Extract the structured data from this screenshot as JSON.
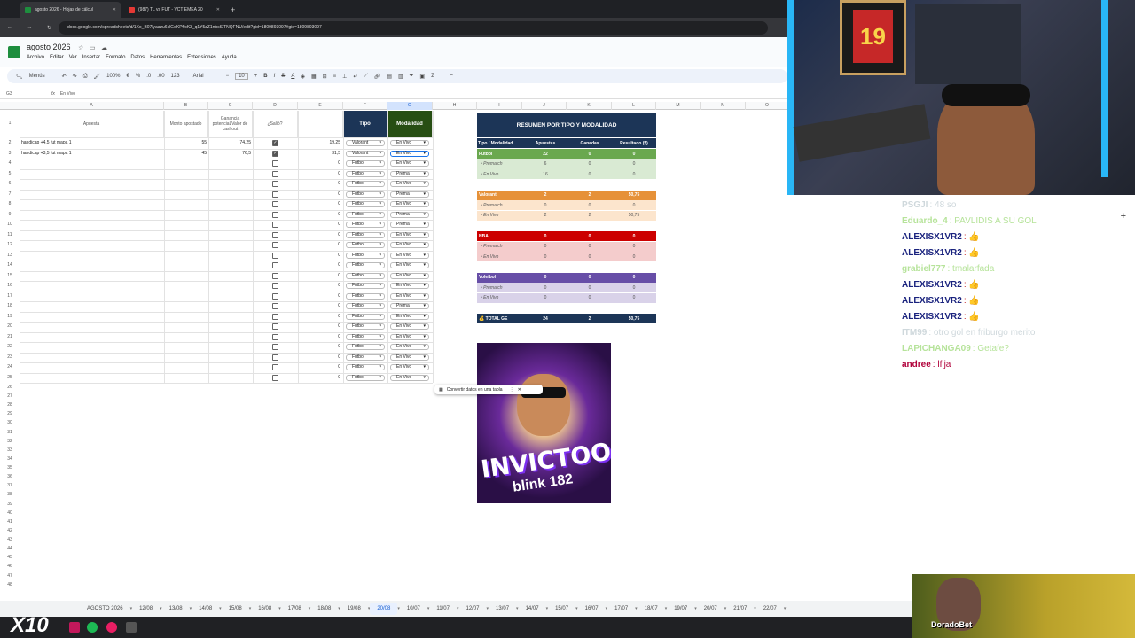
{
  "browser": {
    "tabs": [
      {
        "label": "agosto 2026 - Hojas de cálcul",
        "active": true
      },
      {
        "label": "(987) TL vs FUT - VCT EMEA 20",
        "active": false
      }
    ],
    "url": "docs.google.com/spreadsheets/d/1Xo_B07lyaazu6clGqKPffcK3_q1Y5zZ1nbcSiTNQFNU/edit?gid=1809893097#gid=1809893097"
  },
  "sheets": {
    "doc_title": "agosto 2026",
    "menu": [
      "Archivo",
      "Editar",
      "Ver",
      "Insertar",
      "Formato",
      "Datos",
      "Herramientas",
      "Extensiones",
      "Ayuda"
    ],
    "toolbar": {
      "menus": "Menús",
      "zoom": "100%",
      "font": "Arial",
      "font_size": "10",
      "fmt_123": "123"
    },
    "cell_ref": "G3",
    "formula": "En Vivo",
    "columns": [
      "A",
      "B",
      "C",
      "D",
      "E",
      "F",
      "G",
      "H",
      "I",
      "J",
      "K",
      "L",
      "M",
      "N",
      "O"
    ],
    "headers": {
      "apuesta": "Apuesta",
      "monto": "Monto apostado",
      "ganancia": "Ganancia potencial/Valor de cashout",
      "salio": "¿Salió?",
      "tipo": "Tipo",
      "modalidad": "Modalidad"
    },
    "rows": [
      {
        "n": "1"
      },
      {
        "n": "2",
        "apuesta": "handicap +4,5 fut mapa 1",
        "monto": "55",
        "ganancia": "74,25",
        "check": true,
        "e": "19,25",
        "tipo": "Valorant",
        "mod": "En Vivo"
      },
      {
        "n": "3",
        "apuesta": "handicap +3,5 fut mapa 1",
        "monto": "45",
        "ganancia": "76,5",
        "check": true,
        "e": "31,5",
        "tipo": "Valorant",
        "mod": "En Vivo"
      },
      {
        "n": "4",
        "e": "0",
        "tipo": "Fútbol",
        "mod": "En Vivo"
      },
      {
        "n": "5",
        "e": "0",
        "tipo": "Fútbol",
        "mod": "Prema"
      },
      {
        "n": "6",
        "e": "0",
        "tipo": "Fútbol",
        "mod": "En Vivo"
      },
      {
        "n": "7",
        "e": "0",
        "tipo": "Fútbol",
        "mod": "Prema"
      },
      {
        "n": "8",
        "e": "0",
        "tipo": "Fútbol",
        "mod": "En Vivo"
      },
      {
        "n": "9",
        "e": "0",
        "tipo": "Fútbol",
        "mod": "Prema"
      },
      {
        "n": "10",
        "e": "0",
        "tipo": "Fútbol",
        "mod": "Prema"
      },
      {
        "n": "11",
        "e": "0",
        "tipo": "Fútbol",
        "mod": "En Vivo"
      },
      {
        "n": "12",
        "e": "0",
        "tipo": "Fútbol",
        "mod": "En Vivo"
      },
      {
        "n": "13",
        "e": "0",
        "tipo": "Fútbol",
        "mod": "En Vivo"
      },
      {
        "n": "14",
        "e": "0",
        "tipo": "Fútbol",
        "mod": "En Vivo"
      },
      {
        "n": "15",
        "e": "0",
        "tipo": "Fútbol",
        "mod": "En Vivo"
      },
      {
        "n": "16",
        "e": "0",
        "tipo": "Fútbol",
        "mod": "En Vivo"
      },
      {
        "n": "17",
        "e": "0",
        "tipo": "Fútbol",
        "mod": "En Vivo"
      },
      {
        "n": "18",
        "e": "0",
        "tipo": "Fútbol",
        "mod": "Prema"
      },
      {
        "n": "19",
        "e": "0",
        "tipo": "Fútbol",
        "mod": "En Vivo"
      },
      {
        "n": "20",
        "e": "0",
        "tipo": "Fútbol",
        "mod": "En Vivo"
      },
      {
        "n": "21",
        "e": "0",
        "tipo": "Fútbol",
        "mod": "En Vivo"
      },
      {
        "n": "22",
        "e": "0",
        "tipo": "Fútbol",
        "mod": "En Vivo"
      },
      {
        "n": "23",
        "e": "0",
        "tipo": "Fútbol",
        "mod": "En Vivo"
      },
      {
        "n": "24",
        "e": "0",
        "tipo": "Fútbol",
        "mod": "En Vivo"
      },
      {
        "n": "25",
        "e": "0",
        "tipo": "Fútbol",
        "mod": "En Vivo"
      }
    ],
    "extra_row_numbers": [
      "26",
      "27",
      "28",
      "29",
      "30",
      "31",
      "32",
      "33",
      "34",
      "35",
      "36",
      "37",
      "38",
      "39",
      "40",
      "41",
      "42",
      "43",
      "44",
      "45",
      "46",
      "47",
      "48"
    ],
    "summary": {
      "title": "RESUMEN POR TIPO Y MODALIDAD",
      "header": [
        "Tipo / Modalidad",
        "Apuestas",
        "Ganadas",
        "Resultado ($)"
      ],
      "rows": [
        {
          "kind": "main",
          "label": "Fútbol",
          "a": "22",
          "g": "0",
          "r": "0",
          "color": "#6aa84f",
          "sub": "#d9ead3"
        },
        {
          "kind": "sub",
          "label": "• Prematch",
          "a": "6",
          "g": "0",
          "r": "0",
          "sub": "#d9ead3"
        },
        {
          "kind": "sub",
          "label": "• En Vivo",
          "a": "16",
          "g": "0",
          "r": "0",
          "sub": "#d9ead3"
        },
        {
          "kind": "gap"
        },
        {
          "kind": "main",
          "label": "Valorant",
          "a": "2",
          "g": "2",
          "r": "50,75",
          "color": "#e69138",
          "sub": "#fce5cd"
        },
        {
          "kind": "sub",
          "label": "• Prematch",
          "a": "0",
          "g": "0",
          "r": "0",
          "sub": "#fce5cd"
        },
        {
          "kind": "sub",
          "label": "• En Vivo",
          "a": "2",
          "g": "2",
          "r": "50,75",
          "sub": "#fce5cd"
        },
        {
          "kind": "gap"
        },
        {
          "kind": "main",
          "label": "NBA",
          "a": "0",
          "g": "0",
          "r": "0",
          "color": "#cc0000",
          "sub": "#f4cccc"
        },
        {
          "kind": "sub",
          "label": "• Prematch",
          "a": "0",
          "g": "0",
          "r": "0",
          "sub": "#f4cccc"
        },
        {
          "kind": "sub",
          "label": "• En Vivo",
          "a": "0",
          "g": "0",
          "r": "0",
          "sub": "#f4cccc"
        },
        {
          "kind": "gap"
        },
        {
          "kind": "main",
          "label": "Voleibol",
          "a": "0",
          "g": "0",
          "r": "0",
          "color": "#674ea7",
          "sub": "#d9d2e9"
        },
        {
          "kind": "sub",
          "label": "• Prematch",
          "a": "0",
          "g": "0",
          "r": "0",
          "sub": "#d9d2e9"
        },
        {
          "kind": "sub",
          "label": "• En Vivo",
          "a": "0",
          "g": "0",
          "r": "0",
          "sub": "#d9d2e9"
        },
        {
          "kind": "gap"
        },
        {
          "kind": "total",
          "label": "💰 TOTAL GE",
          "a": "24",
          "g": "2",
          "r": "50,75",
          "color": "#1c3557"
        }
      ]
    },
    "toast": "Convertir datos en una tabla",
    "poster_text": "INVICTOOOS",
    "poster_sub": "blink 182",
    "sheet_tabs": [
      "AGOSTO 2026",
      "12/08",
      "13/08",
      "14/08",
      "15/08",
      "16/08",
      "17/08",
      "18/08",
      "19/08",
      "20/08",
      "10/07",
      "11/07",
      "12/07",
      "13/07",
      "14/07",
      "15/07",
      "16/07",
      "17/07",
      "18/07",
      "19/07",
      "20/07",
      "21/07",
      "22/07"
    ],
    "active_tab": "20/08"
  },
  "chat": [
    {
      "user": "PSGJI",
      "text": ": 48 so",
      "color": "#cfd8dc"
    },
    {
      "user": "Eduardo_4",
      "text": ": PAVLIDIS A SU GOL",
      "color": "#b6e39a"
    },
    {
      "user": "ALEXISX1VR2",
      "text": ": 👍",
      "color": "#1a237e"
    },
    {
      "user": "ALEXISX1VR2",
      "text": ": 👍",
      "color": "#1a237e"
    },
    {
      "user": "grabiel777",
      "text": ": tmalarfada",
      "color": "#b6e39a"
    },
    {
      "user": "ALEXISX1VR2",
      "text": ": 👍",
      "color": "#1a237e"
    },
    {
      "user": "ALEXISX1VR2",
      "text": ": 👍",
      "color": "#1a237e"
    },
    {
      "user": "ALEXISX1VR2",
      "text": ": 👍",
      "color": "#1a237e"
    },
    {
      "user": "ITM99",
      "text": ": otro gol en friburgo merito",
      "color": "#cfd8dc"
    },
    {
      "user": "LAPICHANGA09",
      "text": ": Getafe?",
      "color": "#b6e39a"
    },
    {
      "user": "andree",
      "text": ": lfija",
      "color": "#b0003a"
    }
  ],
  "cam_label": "DoradoBet",
  "jersey_number": "19",
  "overlay_badge": "X10"
}
